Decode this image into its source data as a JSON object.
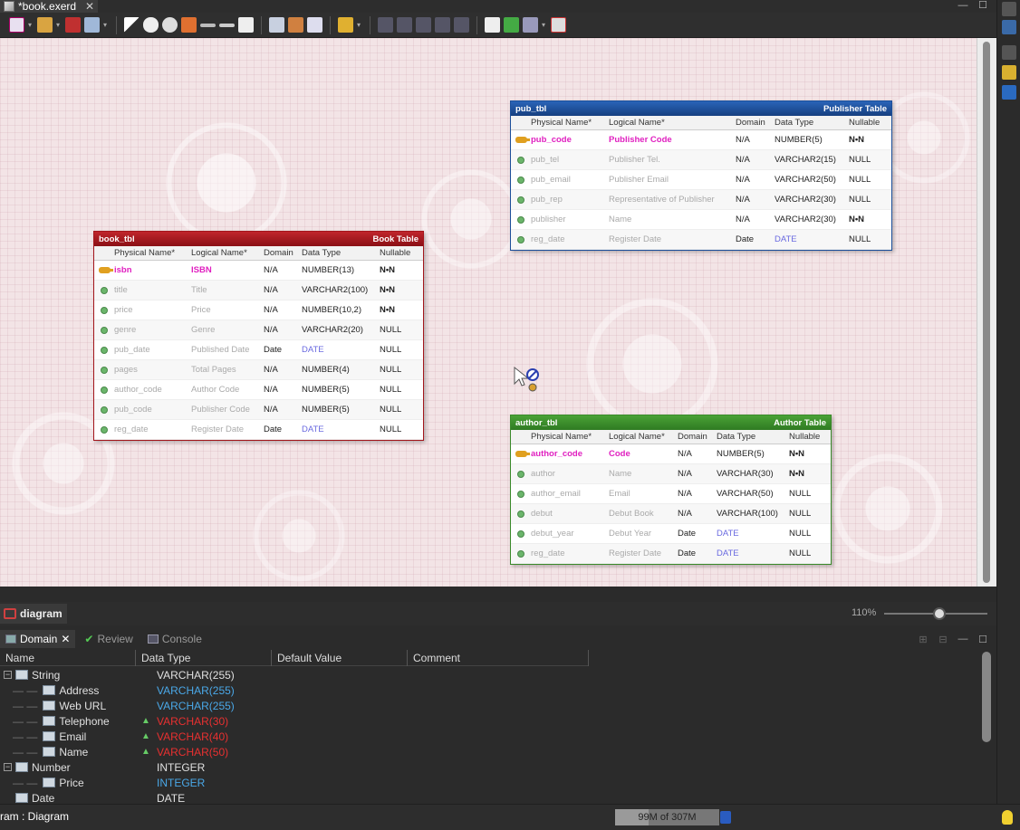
{
  "editor_tab": {
    "title": "*book.exerd",
    "close": "✕"
  },
  "window_controls": {
    "minimize": "—",
    "maximize": "☐"
  },
  "tables": {
    "pub": {
      "name": "pub_tbl",
      "label": "Publisher Table",
      "header_color": "#1c4f9a",
      "columns": [
        "Physical Name*",
        "Logical Name*",
        "Domain",
        "Data Type",
        "Nullable"
      ],
      "rows": [
        {
          "pk": true,
          "physical": "pub_code",
          "logical": "Publisher Code",
          "domain": "N/A",
          "type": "NUMBER(5)",
          "nullable": "N•N"
        },
        {
          "pk": false,
          "physical": "pub_tel",
          "logical": "Publisher Tel.",
          "domain": "N/A",
          "type": "VARCHAR2(15)",
          "nullable": "NULL"
        },
        {
          "pk": false,
          "physical": "pub_email",
          "logical": "Publisher Email",
          "domain": "N/A",
          "type": "VARCHAR2(50)",
          "nullable": "NULL"
        },
        {
          "pk": false,
          "physical": "pub_rep",
          "logical": "Representative of Publisher",
          "domain": "N/A",
          "type": "VARCHAR2(30)",
          "nullable": "NULL"
        },
        {
          "pk": false,
          "physical": "publisher",
          "logical": "Name",
          "domain": "N/A",
          "type": "VARCHAR2(30)",
          "nullable": "N•N"
        },
        {
          "pk": false,
          "physical": "reg_date",
          "logical": "Register Date",
          "domain": "Date",
          "type": "DATE",
          "nullable": "NULL"
        }
      ]
    },
    "book": {
      "name": "book_tbl",
      "label": "Book Table",
      "header_color": "#a3161c",
      "columns": [
        "Physical Name*",
        "Logical Name*",
        "Domain",
        "Data Type",
        "Nullable"
      ],
      "rows": [
        {
          "pk": true,
          "physical": "isbn",
          "logical": "ISBN",
          "domain": "N/A",
          "type": "NUMBER(13)",
          "nullable": "N•N"
        },
        {
          "pk": false,
          "physical": "title",
          "logical": "Title",
          "domain": "N/A",
          "type": "VARCHAR2(100)",
          "nullable": "N•N"
        },
        {
          "pk": false,
          "physical": "price",
          "logical": "Price",
          "domain": "N/A",
          "type": "NUMBER(10,2)",
          "nullable": "N•N"
        },
        {
          "pk": false,
          "physical": "genre",
          "logical": "Genre",
          "domain": "N/A",
          "type": "VARCHAR2(20)",
          "nullable": "NULL"
        },
        {
          "pk": false,
          "physical": "pub_date",
          "logical": "Published Date",
          "domain": "Date",
          "type": "DATE",
          "nullable": "NULL"
        },
        {
          "pk": false,
          "physical": "pages",
          "logical": "Total Pages",
          "domain": "N/A",
          "type": "NUMBER(4)",
          "nullable": "NULL"
        },
        {
          "pk": false,
          "physical": "author_code",
          "logical": "Author Code",
          "domain": "N/A",
          "type": "NUMBER(5)",
          "nullable": "NULL"
        },
        {
          "pk": false,
          "physical": "pub_code",
          "logical": "Publisher Code",
          "domain": "N/A",
          "type": "NUMBER(5)",
          "nullable": "NULL"
        },
        {
          "pk": false,
          "physical": "reg_date",
          "logical": "Register Date",
          "domain": "Date",
          "type": "DATE",
          "nullable": "NULL"
        }
      ]
    },
    "author": {
      "name": "author_tbl",
      "label": "Author Table",
      "header_color": "#3a8a2a",
      "columns": [
        "Physical Name*",
        "Logical Name*",
        "Domain",
        "Data Type",
        "Nullable"
      ],
      "rows": [
        {
          "pk": true,
          "physical": "author_code",
          "logical": "Code",
          "domain": "N/A",
          "type": "NUMBER(5)",
          "nullable": "N•N"
        },
        {
          "pk": false,
          "physical": "author",
          "logical": "Name",
          "domain": "N/A",
          "type": "VARCHAR(30)",
          "nullable": "N•N"
        },
        {
          "pk": false,
          "physical": "author_email",
          "logical": "Email",
          "domain": "N/A",
          "type": "VARCHAR(50)",
          "nullable": "NULL"
        },
        {
          "pk": false,
          "physical": "debut",
          "logical": "Debut Book",
          "domain": "N/A",
          "type": "VARCHAR(100)",
          "nullable": "NULL"
        },
        {
          "pk": false,
          "physical": "debut_year",
          "logical": "Debut Year",
          "domain": "Date",
          "type": "DATE",
          "nullable": "NULL"
        },
        {
          "pk": false,
          "physical": "reg_date",
          "logical": "Register Date",
          "domain": "Date",
          "type": "DATE",
          "nullable": "NULL"
        }
      ]
    }
  },
  "diagram_tab": {
    "label": "diagram"
  },
  "zoom": {
    "label": "110%",
    "value": 110
  },
  "views": {
    "tabs": [
      {
        "label": "Domain",
        "active": true
      },
      {
        "label": "Review",
        "active": false
      },
      {
        "label": "Console",
        "active": false
      }
    ],
    "columns": [
      "Name",
      "Data Type",
      "Default Value",
      "Comment"
    ],
    "rows": [
      {
        "level": 0,
        "expander": "−",
        "name": "String",
        "type": "VARCHAR(255)",
        "style": "normal",
        "warn": false
      },
      {
        "level": 1,
        "name": "Address",
        "type": "VARCHAR(255)",
        "style": "blue",
        "warn": false
      },
      {
        "level": 1,
        "name": "Web URL",
        "type": "VARCHAR(255)",
        "style": "blue",
        "warn": false
      },
      {
        "level": 1,
        "name": "Telephone",
        "type": "VARCHAR(30)",
        "style": "red",
        "warn": true
      },
      {
        "level": 1,
        "name": "Email",
        "type": "VARCHAR(40)",
        "style": "red",
        "warn": true
      },
      {
        "level": 1,
        "name": "Name",
        "type": "VARCHAR(50)",
        "style": "red",
        "warn": true
      },
      {
        "level": 0,
        "expander": "−",
        "name": "Number",
        "type": "INTEGER",
        "style": "normal",
        "warn": false
      },
      {
        "level": 1,
        "name": "Price",
        "type": "INTEGER",
        "style": "blue",
        "warn": false
      },
      {
        "level": 0,
        "expander": "",
        "name": "Date",
        "type": "DATE",
        "style": "normal",
        "warn": false
      }
    ]
  },
  "status": {
    "text": "ram : Diagram",
    "heap": "99M of 307M",
    "heap_used_fraction": 0.32
  }
}
